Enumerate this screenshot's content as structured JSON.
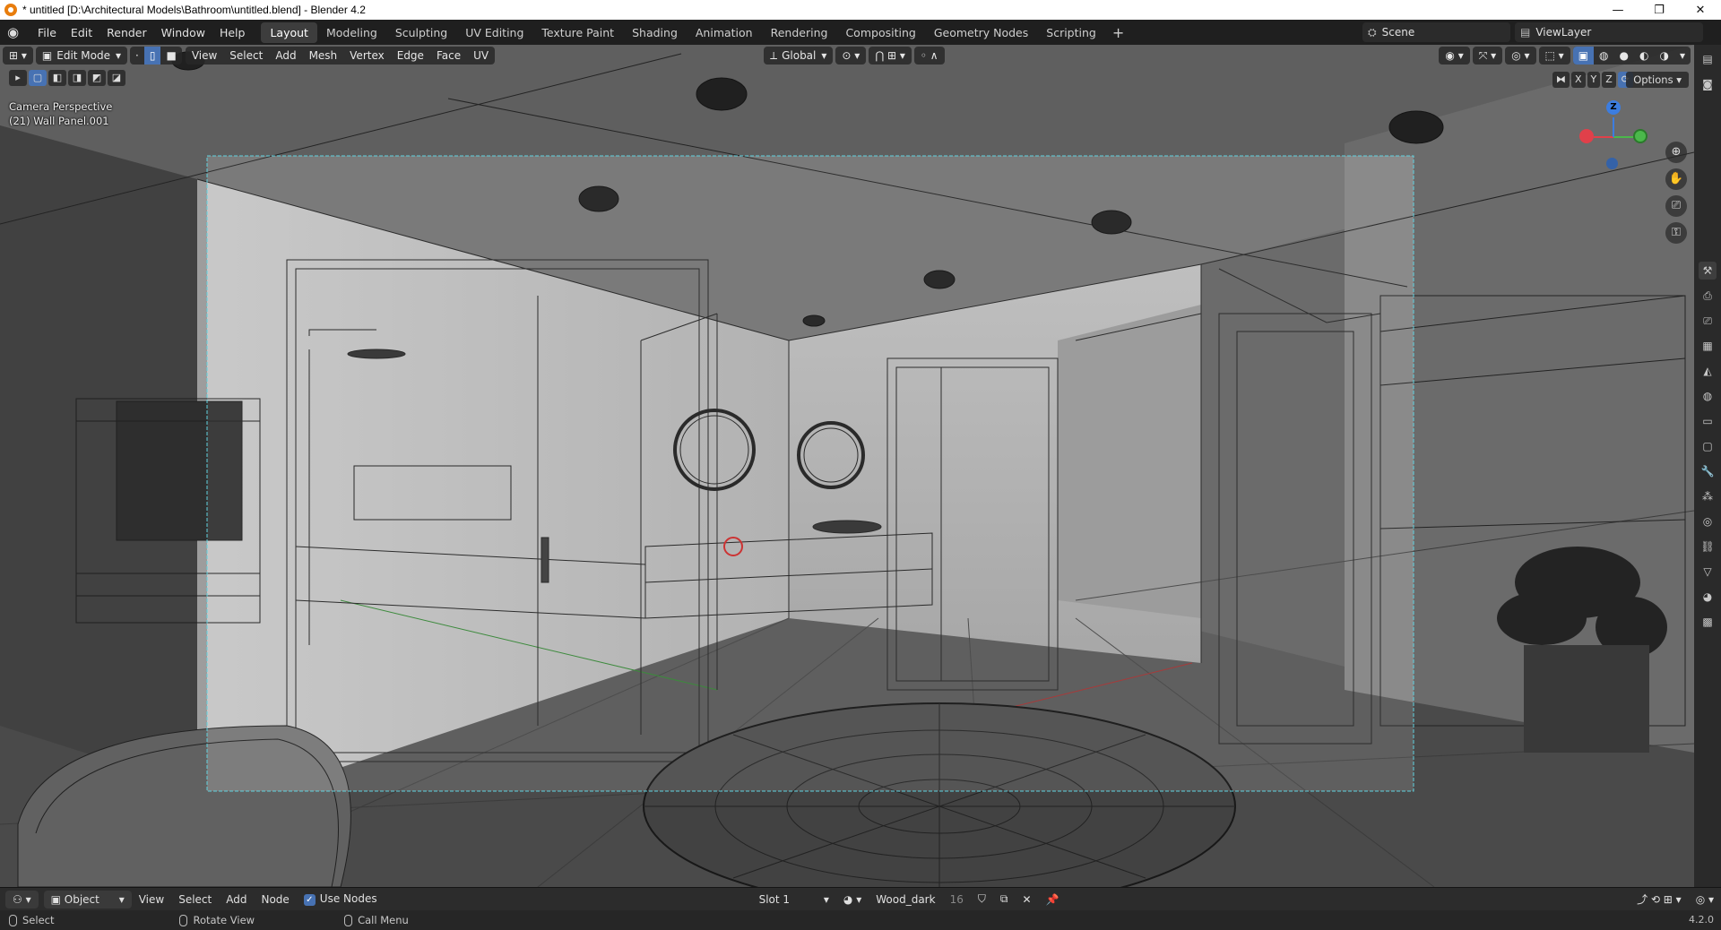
{
  "window": {
    "title": "* untitled [D:\\Architectural Models\\Bathroom\\untitled.blend] - Blender 4.2",
    "minimize": "—",
    "maximize": "❐",
    "close": "✕"
  },
  "topbar": {
    "menus": [
      "File",
      "Edit",
      "Render",
      "Window",
      "Help"
    ],
    "workspaces": [
      "Layout",
      "Modeling",
      "Sculpting",
      "UV Editing",
      "Texture Paint",
      "Shading",
      "Animation",
      "Rendering",
      "Compositing",
      "Geometry Nodes",
      "Scripting"
    ],
    "active_workspace": "Layout",
    "add_workspace": "+",
    "scene_label": "Scene",
    "view_layer_label": "ViewLayer"
  },
  "viewport": {
    "mode": "Edit Mode",
    "menus": [
      "View",
      "Select",
      "Add",
      "Mesh",
      "Vertex",
      "Edge",
      "Face",
      "UV"
    ],
    "transform_orientation": "Global",
    "camera_text": "Camera Perspective",
    "object_text": "(21) Wall Panel.001",
    "axis_toggles": [
      "X",
      "Y",
      "Z"
    ],
    "options_label": "Options",
    "gizmo": {
      "z": "Z",
      "x_color": "#e0404a",
      "y_color": "#4bb84b",
      "z_color": "#3c7de0"
    }
  },
  "shader_editor": {
    "editor_label": "Object",
    "menus": [
      "View",
      "Select",
      "Add",
      "Node"
    ],
    "use_nodes_label": "Use Nodes",
    "use_nodes_checked": true,
    "slot": "Slot 1",
    "material": "Wood_dark",
    "users": "16"
  },
  "statusbar": {
    "select": "Select",
    "rotate": "Rotate View",
    "call_menu": "Call Menu",
    "version": "4.2.0"
  },
  "colors": {
    "accent": "#4772b3",
    "camera_frame": "#5fd3e0",
    "blender_orange": "#e87d0d"
  }
}
